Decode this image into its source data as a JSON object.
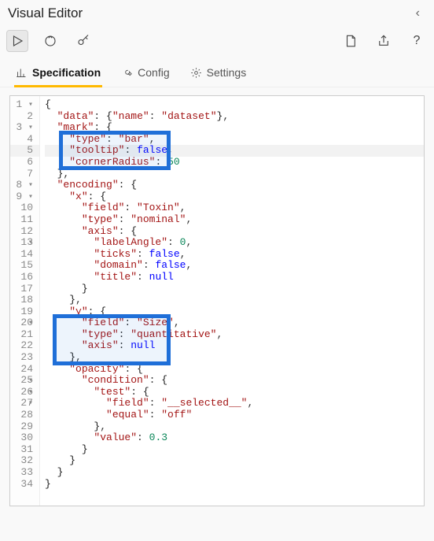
{
  "title": "Visual Editor",
  "toolbar": {
    "apply": "apply",
    "zoom": "zoom",
    "key": "key",
    "new": "new",
    "export": "export",
    "help": "help"
  },
  "tabs": {
    "spec": "Specification",
    "config": "Config",
    "settings": "Settings"
  },
  "code": {
    "lines": [
      "{",
      "  \"data\": {\"name\": \"dataset\"},",
      "  \"mark\": {",
      "    \"type\": \"bar\",",
      "    \"tooltip\": false,",
      "    \"cornerRadius\": 50",
      "  },",
      "  \"encoding\": {",
      "    \"x\": {",
      "      \"field\": \"Toxin\",",
      "      \"type\": \"nominal\",",
      "      \"axis\": {",
      "        \"labelAngle\": 0,",
      "        \"ticks\": false,",
      "        \"domain\": false,",
      "        \"title\": null",
      "      }",
      "    },",
      "    \"y\": {",
      "      \"field\": \"Size\",",
      "      \"type\": \"quantitative\",",
      "      \"axis\": null",
      "    },",
      "    \"opacity\": {",
      "      \"condition\": {",
      "        \"test\": {",
      "          \"field\": \"__selected__\",",
      "          \"equal\": \"off\"",
      "        },",
      "        \"value\": 0.3",
      "      }",
      "    }",
      "  }",
      "}"
    ],
    "currentLine": 5
  },
  "highlights": [
    {
      "startLine": 4,
      "endLine": 6,
      "leftCh": 3,
      "widthCh": 19
    },
    {
      "startLine": 20,
      "endLine": 23,
      "leftCh": 2,
      "widthCh": 20
    }
  ]
}
